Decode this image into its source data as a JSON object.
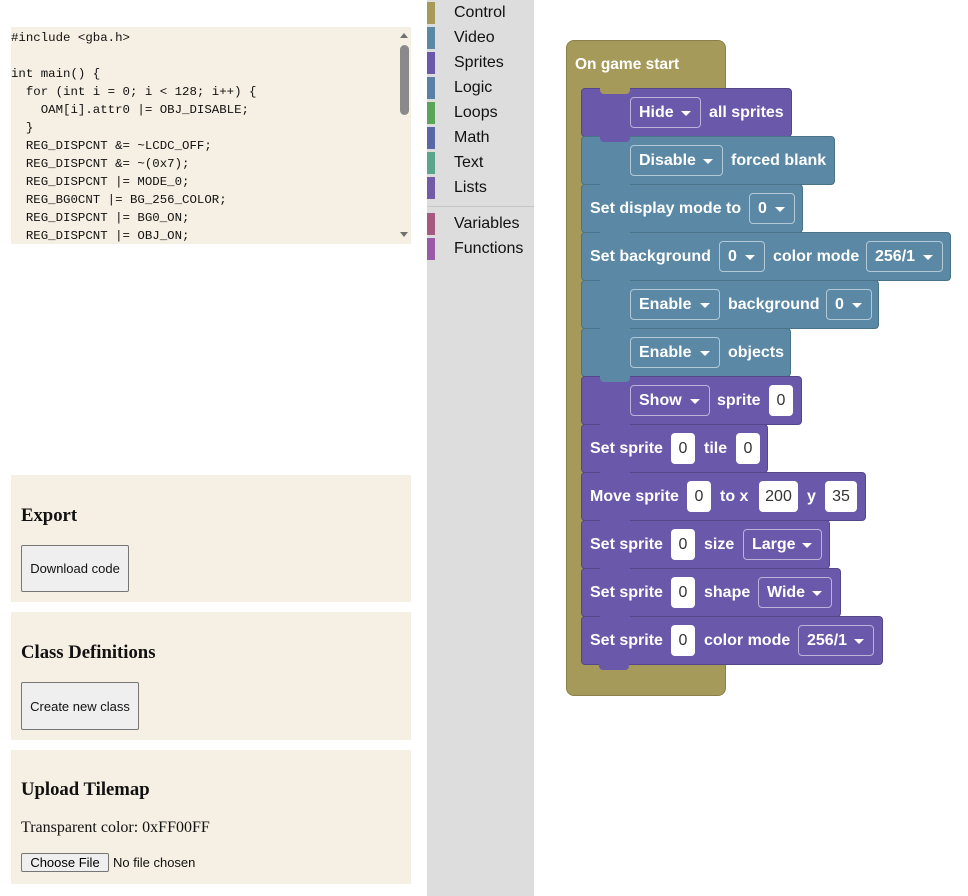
{
  "code": {
    "text": "#include <gba.h>\n\nint main() {\n  for (int i = 0; i < 128; i++) {\n    OAM[i].attr0 |= OBJ_DISABLE;\n  }\n  REG_DISPCNT &= ~LCDC_OFF;\n  REG_DISPCNT &= ~(0x7);\n  REG_DISPCNT |= MODE_0;\n  REG_BG0CNT |= BG_256_COLOR;\n  REG_DISPCNT |= BG0_ON;\n  REG_DISPCNT |= OBJ_ON;"
  },
  "export": {
    "heading": "Export",
    "button": "Download code"
  },
  "classes": {
    "heading": "Class Definitions",
    "button": "Create new class"
  },
  "tilemap": {
    "heading": "Upload Tilemap",
    "transparent": "Transparent color: 0xFF00FF",
    "file_button": "Choose File",
    "file_status": "No file chosen"
  },
  "toolbox": {
    "categories": [
      {
        "label": "Control",
        "color": "#a59a5a"
      },
      {
        "label": "Video",
        "color": "#5a88a5"
      },
      {
        "label": "Sprites",
        "color": "#6a58aa"
      },
      {
        "label": "Logic",
        "color": "#5b80a5"
      },
      {
        "label": "Loops",
        "color": "#5ba55b"
      },
      {
        "label": "Math",
        "color": "#5b67a5"
      },
      {
        "label": "Text",
        "color": "#5ba58c"
      },
      {
        "label": "Lists",
        "color": "#745ba5"
      },
      {
        "label": "Variables",
        "color": "#a55b80"
      },
      {
        "label": "Functions",
        "color": "#995ba5"
      }
    ]
  },
  "blocks": {
    "hat": "On game start",
    "b1": {
      "dd": "Hide",
      "t1": "all sprites"
    },
    "b2": {
      "dd": "Disable",
      "t1": "forced blank"
    },
    "b3": {
      "t1": "Set display mode to",
      "dd": "0"
    },
    "b4": {
      "t1": "Set background",
      "dd1": "0",
      "t2": "color mode",
      "dd2": "256/1"
    },
    "b5": {
      "dd1": "Enable",
      "t1": "background",
      "dd2": "0"
    },
    "b6": {
      "dd": "Enable",
      "t1": "objects"
    },
    "b7": {
      "dd": "Show",
      "t1": "sprite",
      "f1": "0"
    },
    "b8": {
      "t1": "Set sprite",
      "f1": "0",
      "t2": "tile",
      "f2": "0"
    },
    "b9": {
      "t1": "Move sprite",
      "f1": "0",
      "t2": "to x",
      "f2": "200",
      "t3": "y",
      "f3": "35"
    },
    "b10": {
      "t1": "Set sprite",
      "f1": "0",
      "t2": "size",
      "dd": "Large"
    },
    "b11": {
      "t1": "Set sprite",
      "f1": "0",
      "t2": "shape",
      "dd": "Wide"
    },
    "b12": {
      "t1": "Set sprite",
      "f1": "0",
      "t2": "color mode",
      "dd": "256/1"
    }
  }
}
